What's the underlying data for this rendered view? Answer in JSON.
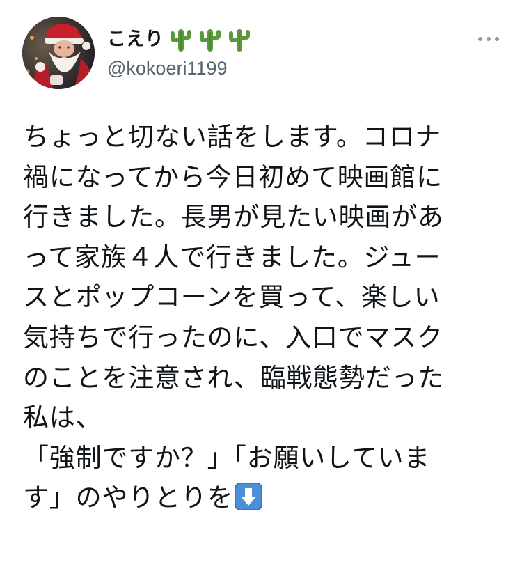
{
  "author": {
    "display_name": "こえり",
    "handle": "@kokoeri1199",
    "name_emojis": [
      "cactus-emoji",
      "cactus-emoji",
      "cactus-emoji"
    ]
  },
  "menu": {
    "icon": "more-horizontal-icon"
  },
  "tweet": {
    "lines": [
      "ちょっと切ない話をします。コロナ",
      "禍になってから今日初めて映画館に",
      "行きました。長男が見たい映画があ",
      "って家族４人で行きました。ジュー",
      "スとポップコーンを買って、楽しい",
      "気持ちで行ったのに、入口でマスク",
      "のことを注意され、臨戦態勢だった",
      "私は、",
      "「強制ですか？」「お願いしていま",
      "す」のやりとりを"
    ],
    "trailing_emoji": "down-arrow-emoji"
  },
  "colors": {
    "text": "#0f1419",
    "secondary": "#536471",
    "cactus": "#5a9a3a",
    "arrow_bg": "#4a8fd8"
  }
}
